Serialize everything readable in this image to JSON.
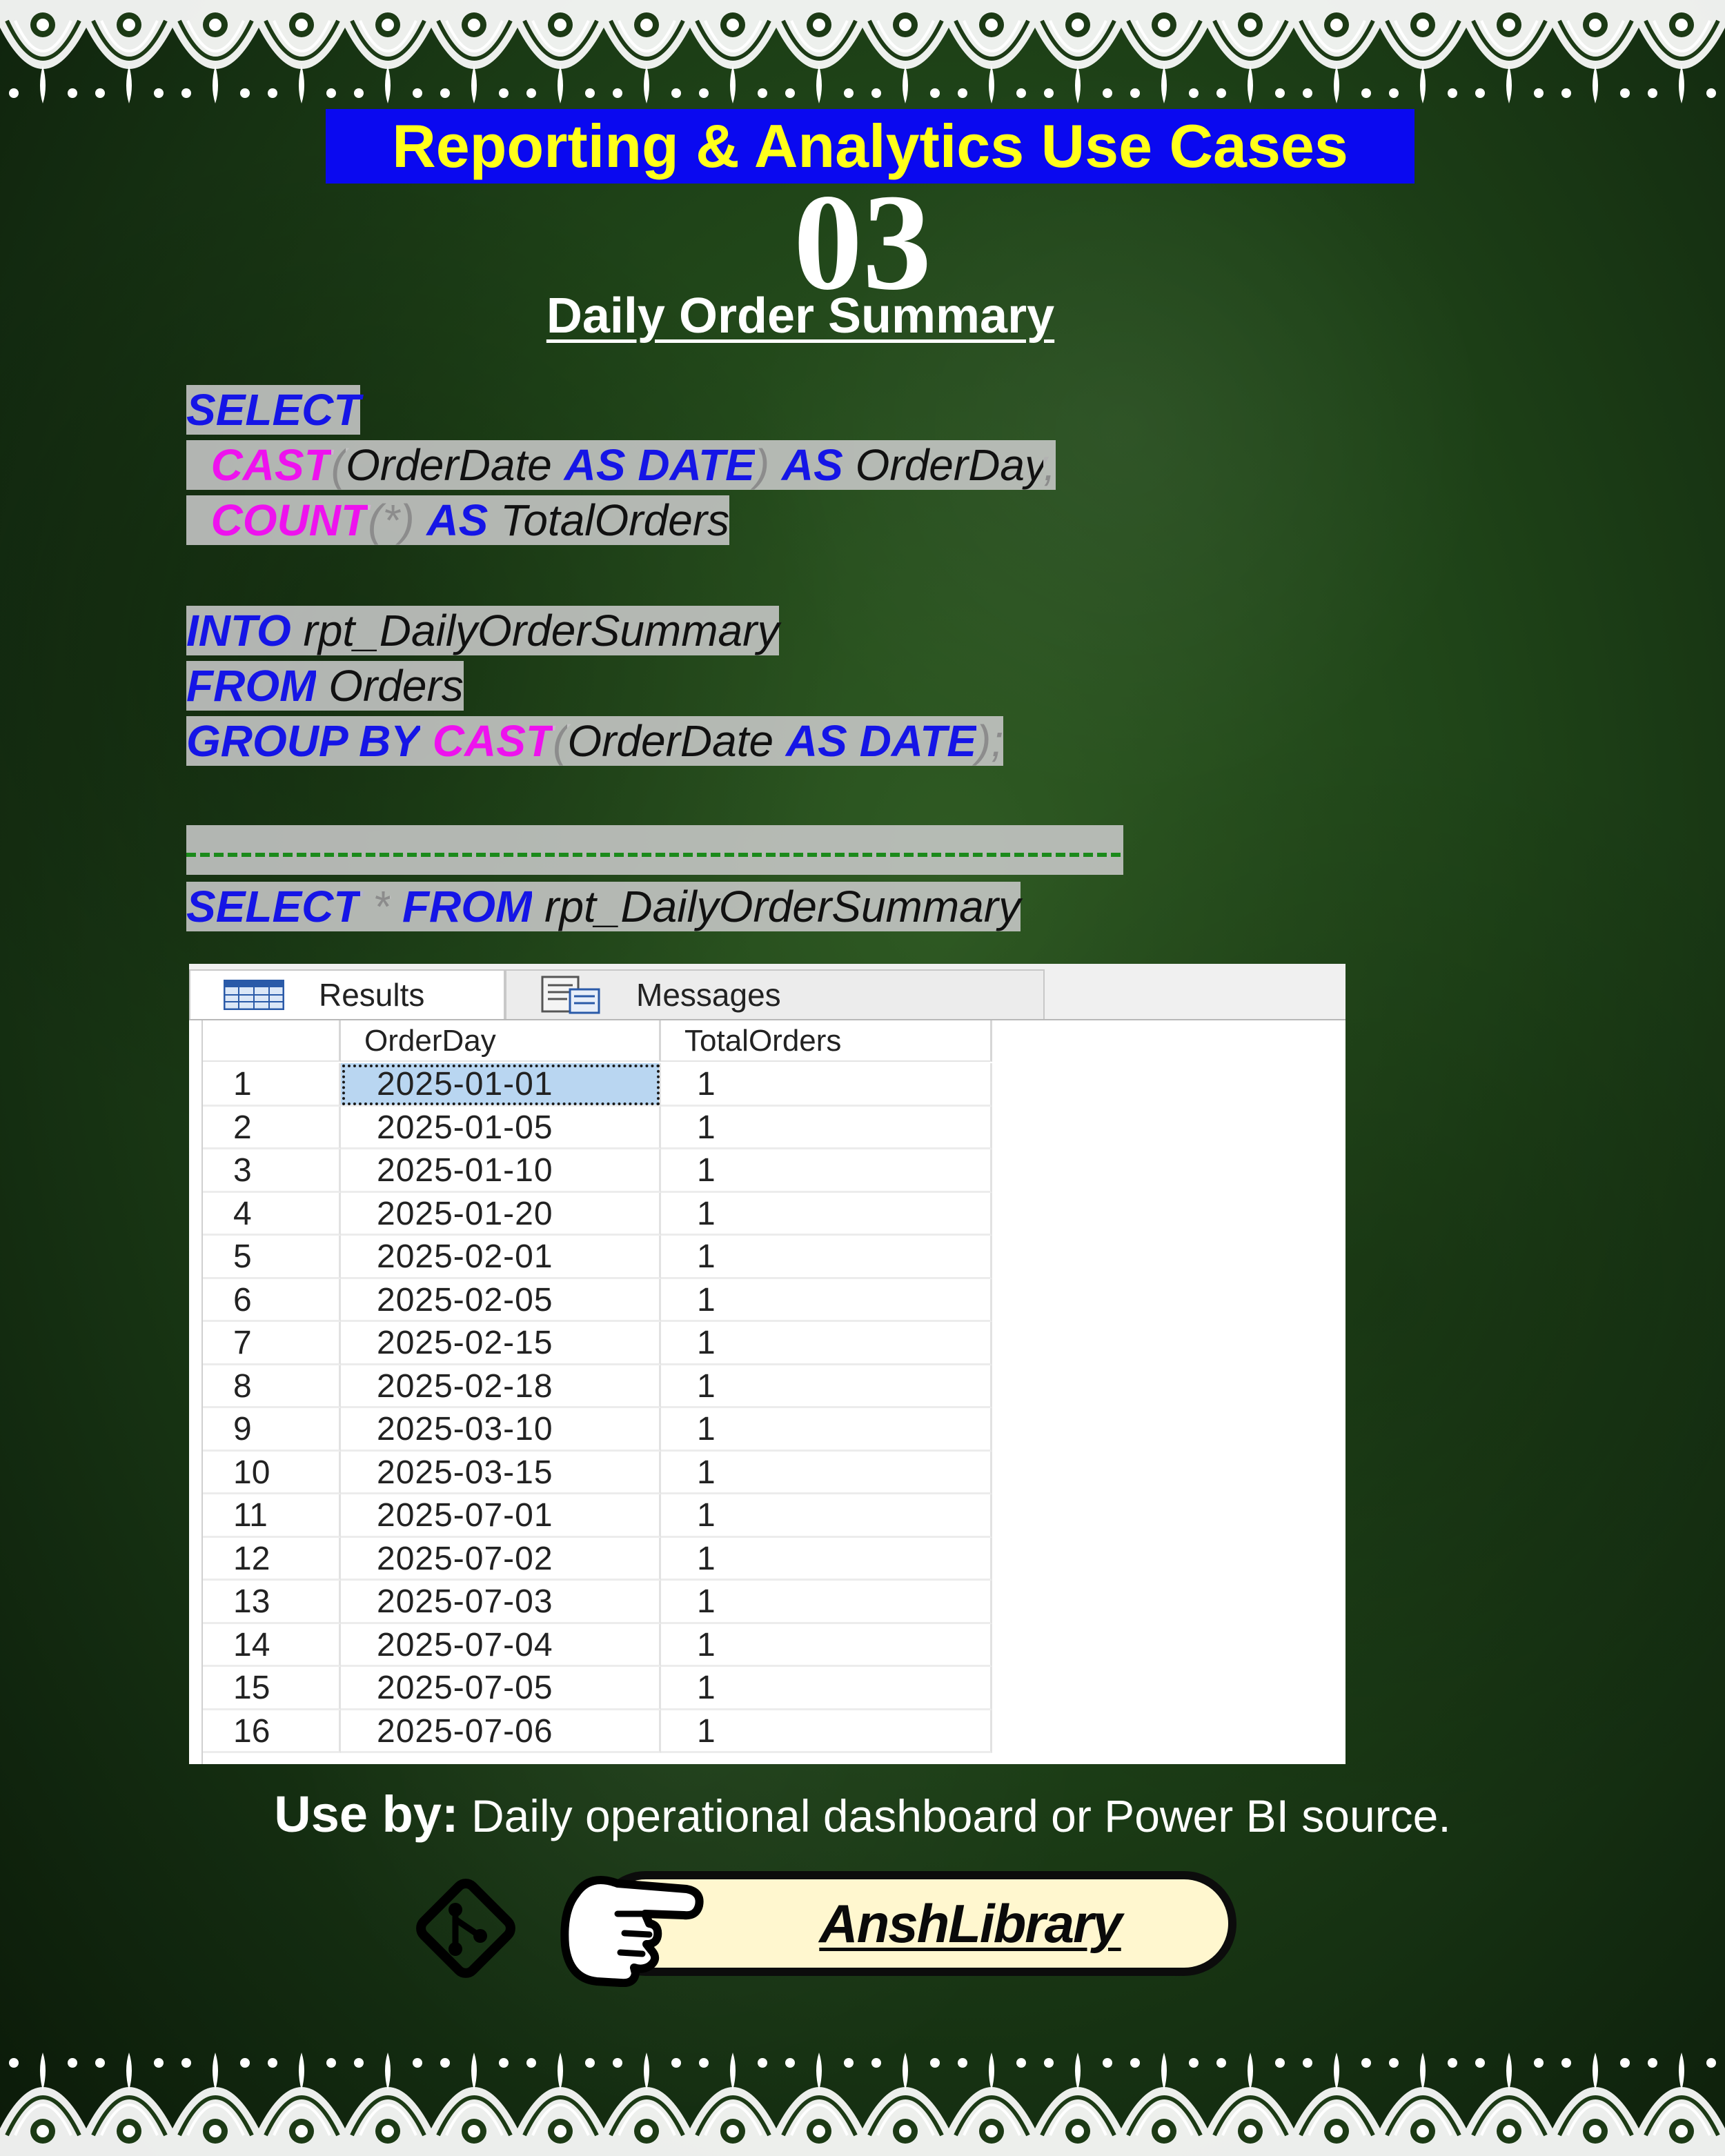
{
  "header": {
    "title": "Reporting & Analytics Use Cases",
    "number": "03",
    "subtitle": "Daily Order Summary"
  },
  "code": {
    "line1": {
      "kw1": "SELECT"
    },
    "line2": {
      "fn": "CAST",
      "p1": "(",
      "id1": "OrderDate",
      "kw1": "AS",
      "kw2": "DATE",
      "p2": ")",
      "kw3": "AS",
      "id2": "OrderDay",
      "p3": ","
    },
    "line3": {
      "fn": "COUNT",
      "p1": "(*)",
      "kw1": "AS",
      "id1": "TotalOrders"
    },
    "line4": {
      "kw1": "INTO",
      "id1": "rpt_DailyOrderSummary"
    },
    "line5": {
      "kw1": "FROM",
      "id1": "Orders"
    },
    "line6": {
      "kw1": "GROUP BY",
      "fn": "CAST",
      "p1": "(",
      "id1": "OrderDate",
      "kw2": "AS",
      "kw3": "DATE",
      "p2": ");"
    },
    "line7": {
      "kw1": "SELECT",
      "p1": "*",
      "kw2": "FROM",
      "id1": "rpt_DailyOrderSummary"
    }
  },
  "results": {
    "tabs": {
      "results": "Results",
      "messages": "Messages"
    },
    "columns": {
      "order_day": "OrderDay",
      "total_orders": "TotalOrders"
    },
    "rows": [
      {
        "n": "1",
        "day": "2025-01-01",
        "total": "1"
      },
      {
        "n": "2",
        "day": "2025-01-05",
        "total": "1"
      },
      {
        "n": "3",
        "day": "2025-01-10",
        "total": "1"
      },
      {
        "n": "4",
        "day": "2025-01-20",
        "total": "1"
      },
      {
        "n": "5",
        "day": "2025-02-01",
        "total": "1"
      },
      {
        "n": "6",
        "day": "2025-02-05",
        "total": "1"
      },
      {
        "n": "7",
        "day": "2025-02-15",
        "total": "1"
      },
      {
        "n": "8",
        "day": "2025-02-18",
        "total": "1"
      },
      {
        "n": "9",
        "day": "2025-03-10",
        "total": "1"
      },
      {
        "n": "10",
        "day": "2025-03-15",
        "total": "1"
      },
      {
        "n": "11",
        "day": "2025-07-01",
        "total": "1"
      },
      {
        "n": "12",
        "day": "2025-07-02",
        "total": "1"
      },
      {
        "n": "13",
        "day": "2025-07-03",
        "total": "1"
      },
      {
        "n": "14",
        "day": "2025-07-04",
        "total": "1"
      },
      {
        "n": "15",
        "day": "2025-07-05",
        "total": "1"
      },
      {
        "n": "16",
        "day": "2025-07-06",
        "total": "1"
      }
    ]
  },
  "footer": {
    "use_by_label": "Use by:",
    "use_by_text": "Daily operational dashboard or Power BI source.",
    "brand": "AnshLibrary"
  },
  "icons": {
    "git": "git-icon",
    "hand": "pointing-hand-icon",
    "grid": "grid-icon",
    "messages": "messages-icon"
  },
  "colors": {
    "keyword": "#1515e6",
    "function": "#ee12ee",
    "title_bg": "#0a09f0",
    "title_text": "#ffff1a",
    "comment": "#1b8a1b",
    "brand_bg": "#fff7cf"
  }
}
